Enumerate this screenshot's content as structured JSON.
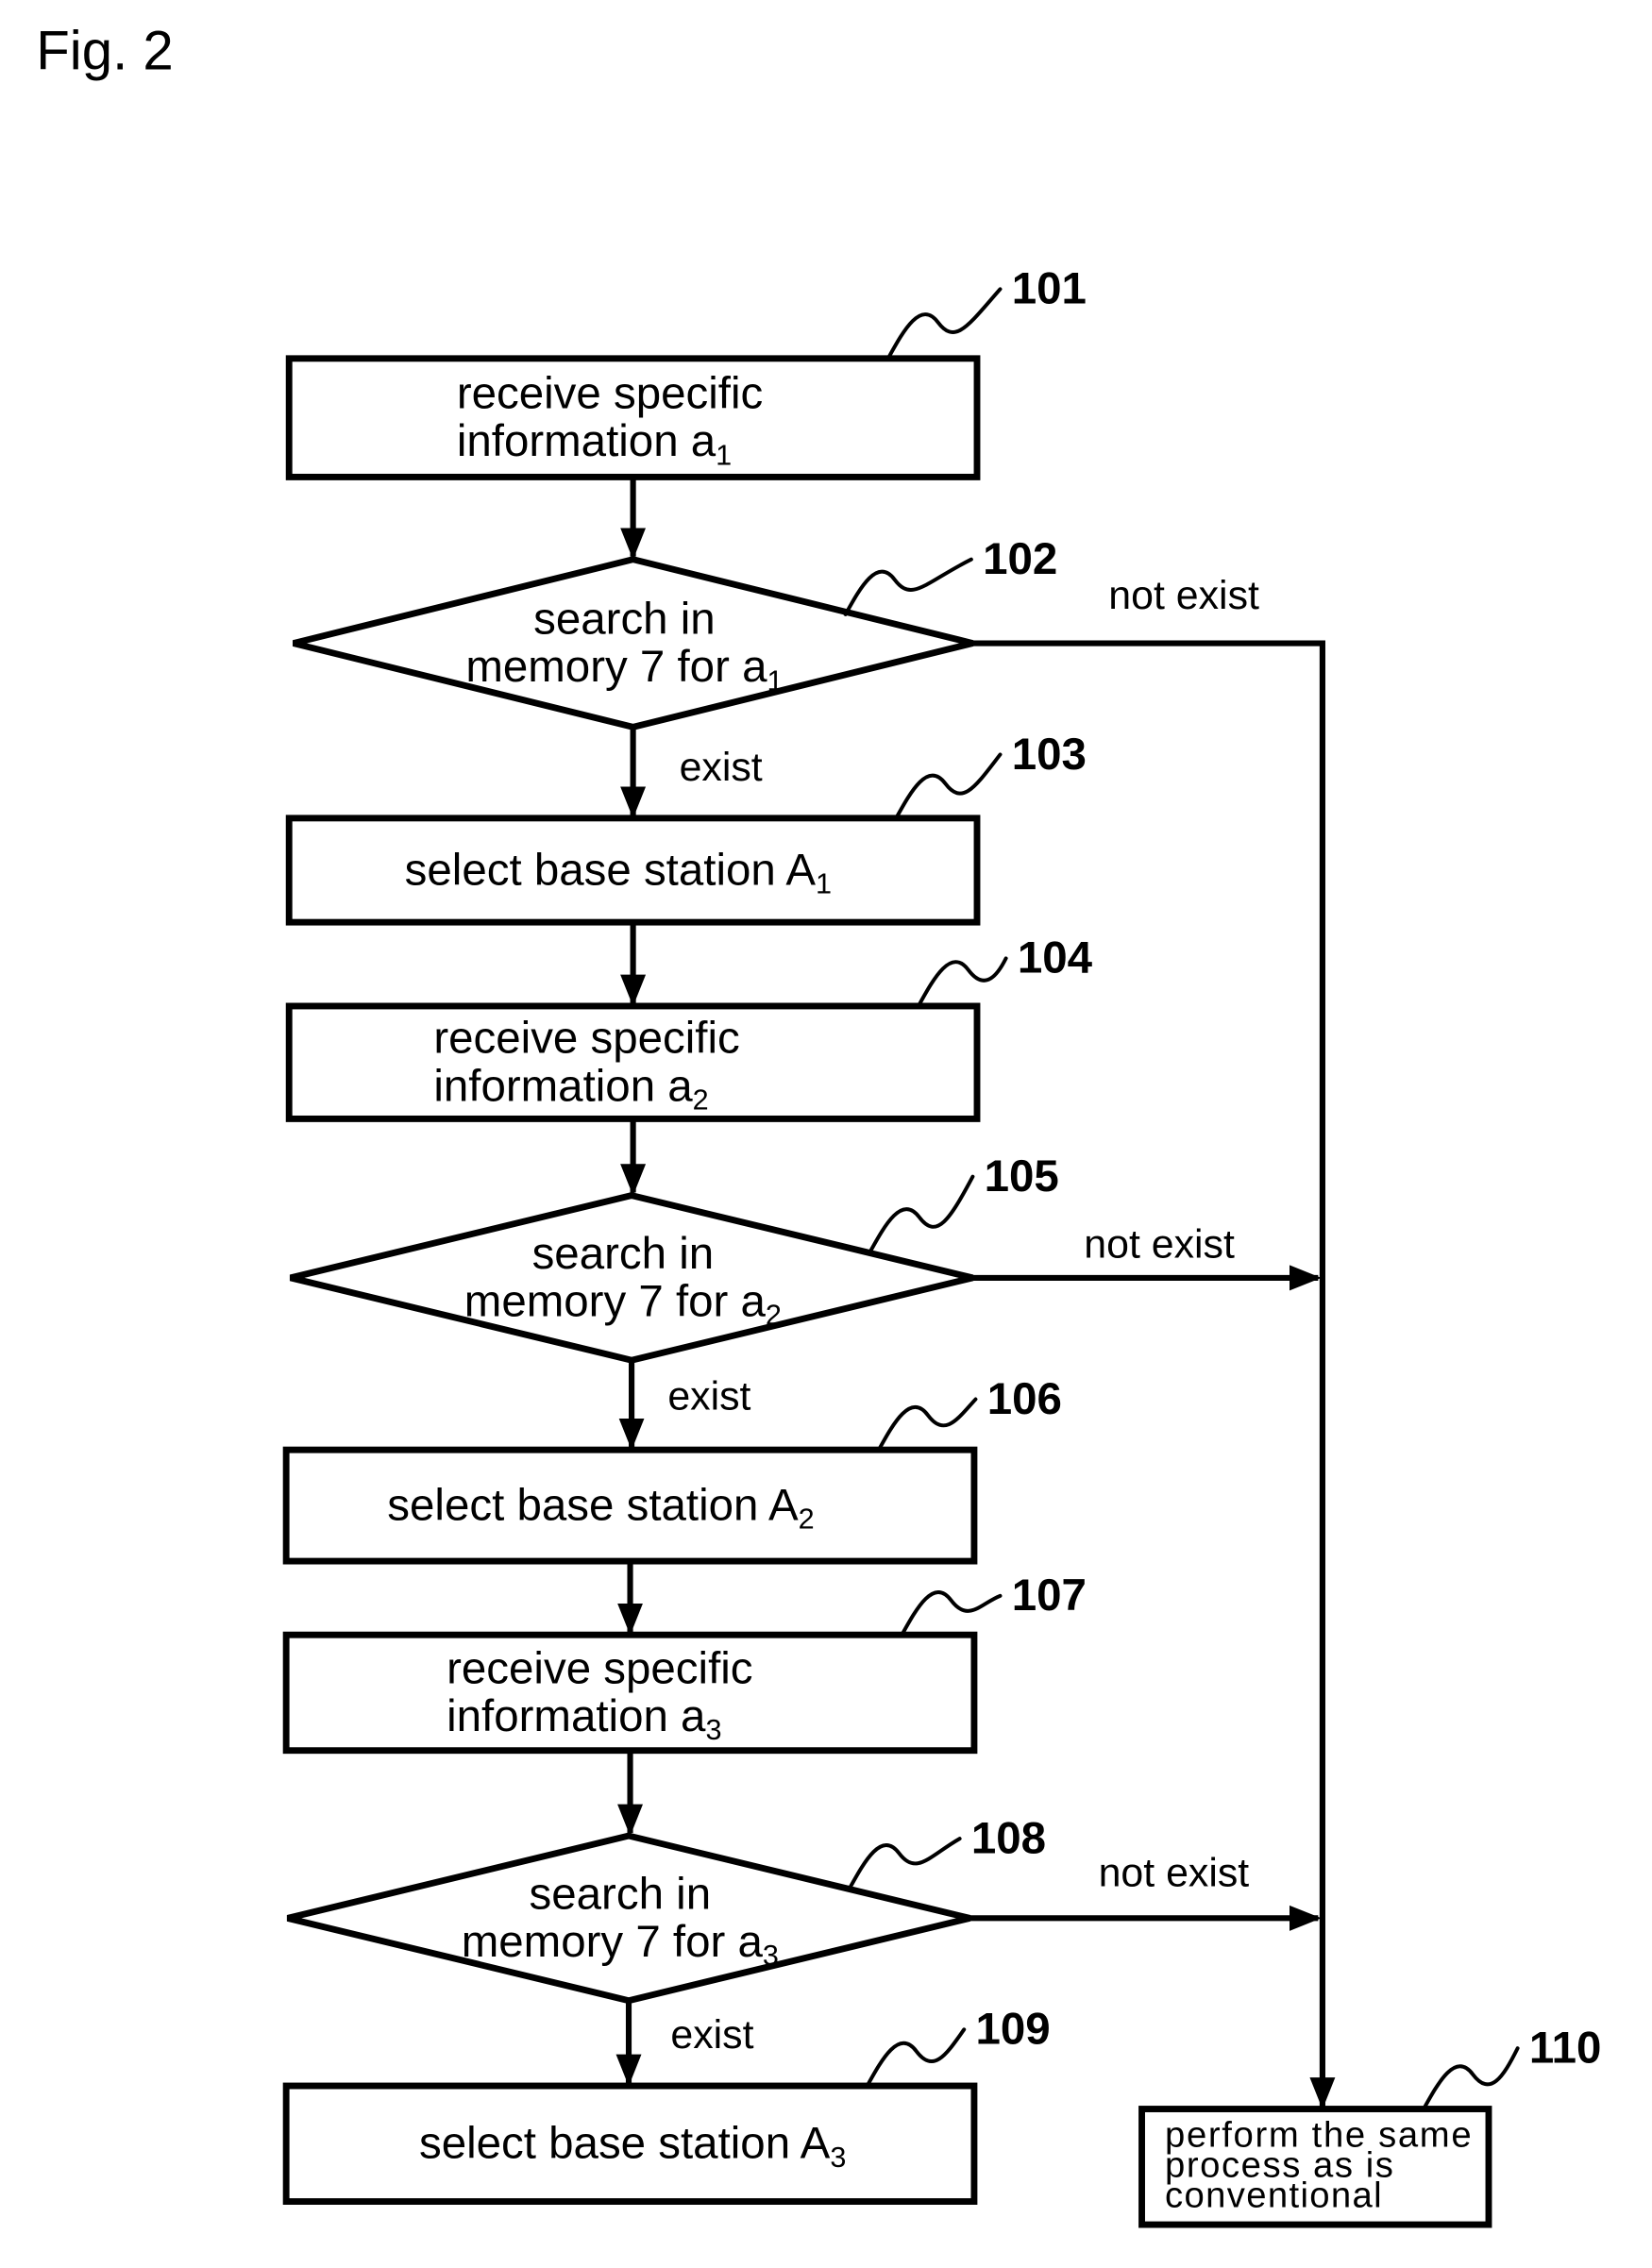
{
  "figure": {
    "title": "Fig. 2"
  },
  "nodes": [
    {
      "id": "101",
      "type": "process",
      "ref": "101",
      "lines": [
        [
          {
            "t": "receive specific"
          }
        ],
        [
          {
            "t": "information a"
          },
          {
            "t": "1",
            "sub": true
          }
        ]
      ]
    },
    {
      "id": "102",
      "type": "decision",
      "ref": "102",
      "lines": [
        [
          {
            "t": "search in"
          }
        ],
        [
          {
            "t": "memory 7 for a"
          },
          {
            "t": "1",
            "sub": true
          }
        ]
      ]
    },
    {
      "id": "103",
      "type": "process",
      "ref": "103",
      "lines": [
        [
          {
            "t": "select base station A"
          },
          {
            "t": "1",
            "sub": true
          }
        ]
      ]
    },
    {
      "id": "104",
      "type": "process",
      "ref": "104",
      "lines": [
        [
          {
            "t": "receive specific"
          }
        ],
        [
          {
            "t": "information a"
          },
          {
            "t": "2",
            "sub": true
          }
        ]
      ]
    },
    {
      "id": "105",
      "type": "decision",
      "ref": "105",
      "lines": [
        [
          {
            "t": "search in"
          }
        ],
        [
          {
            "t": "memory 7 for a"
          },
          {
            "t": "2",
            "sub": true
          }
        ]
      ]
    },
    {
      "id": "106",
      "type": "process",
      "ref": "106",
      "lines": [
        [
          {
            "t": "select base station A"
          },
          {
            "t": "2",
            "sub": true
          }
        ]
      ]
    },
    {
      "id": "107",
      "type": "process",
      "ref": "107",
      "lines": [
        [
          {
            "t": "receive specific"
          }
        ],
        [
          {
            "t": "information a"
          },
          {
            "t": "3",
            "sub": true
          }
        ]
      ]
    },
    {
      "id": "108",
      "type": "decision",
      "ref": "108",
      "lines": [
        [
          {
            "t": "search in"
          }
        ],
        [
          {
            "t": "memory 7 for a"
          },
          {
            "t": "3",
            "sub": true
          }
        ]
      ]
    },
    {
      "id": "109",
      "type": "process",
      "ref": "109",
      "lines": [
        [
          {
            "t": "select base station A"
          },
          {
            "t": "3",
            "sub": true
          }
        ]
      ]
    },
    {
      "id": "110",
      "type": "process",
      "ref": "110",
      "lines": [
        [
          {
            "t": "perform the same"
          }
        ],
        [
          {
            "t": "process as is"
          }
        ],
        [
          {
            "t": "conventional"
          }
        ]
      ]
    }
  ],
  "edges": [
    {
      "id": "e101-102",
      "from": "101",
      "to": "102",
      "label": ""
    },
    {
      "id": "e102-103",
      "from": "102",
      "to": "103",
      "label": "exist"
    },
    {
      "id": "e102-110",
      "from": "102",
      "to": "110",
      "label": "not exist"
    },
    {
      "id": "e103-104",
      "from": "103",
      "to": "104",
      "label": ""
    },
    {
      "id": "e104-105",
      "from": "104",
      "to": "105",
      "label": ""
    },
    {
      "id": "e105-106",
      "from": "105",
      "to": "106",
      "label": "exist"
    },
    {
      "id": "e105-110",
      "from": "105",
      "to": "110",
      "label": "not exist"
    },
    {
      "id": "e106-107",
      "from": "106",
      "to": "107",
      "label": ""
    },
    {
      "id": "e107-108",
      "from": "107",
      "to": "108",
      "label": ""
    },
    {
      "id": "e108-109",
      "from": "108",
      "to": "109",
      "label": "exist"
    },
    {
      "id": "e108-110",
      "from": "108",
      "to": "110",
      "label": "not exist"
    }
  ]
}
